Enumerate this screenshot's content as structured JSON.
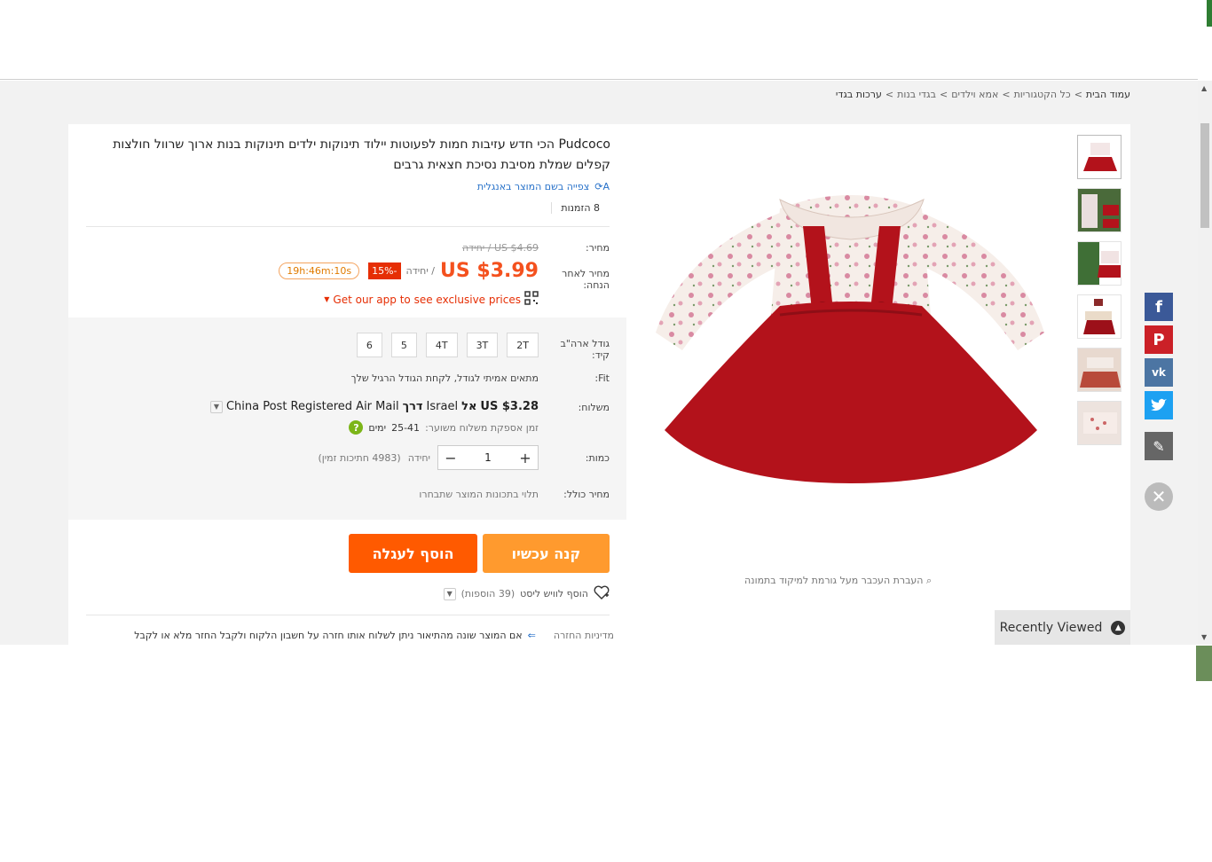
{
  "breadcrumb": [
    "עמוד הבית",
    "כל הקטגוריות",
    "אמא וילדים",
    "בגדי בנות",
    "ערכות בגדי"
  ],
  "product": {
    "title": "Pudcoco הכי חדש עזיבות חמות לפעוטות יילוד תינוקות ילדים תינוקות בנות ארוך שרוול חולצות קפלים שמלת מסיבת נסיכת חצאית גרבים",
    "translate_link": "צפייה בשם המוצר באנגלית",
    "orders": "8 הזמנות"
  },
  "price": {
    "label": "מחיר:",
    "old": "US $4.69 / יחידה",
    "discount_label": "מחיר לאחר הנחה:",
    "current": "US $3.99",
    "unit": "/ יחידה",
    "discount": "-15%",
    "timer": "19h:46m:10s",
    "app_text": "Get our app to see exclusive prices"
  },
  "sku": {
    "size_label": "גודל ארה\"ב קיד:",
    "sizes": [
      "2T",
      "3T",
      "4T",
      "5",
      "6"
    ],
    "fit_label": "Fit:",
    "fit_text": "מתאים אמיתי לגודל, לקחת הגודל הרגיל שלך",
    "ship_label": "משלוח:",
    "ship_price": "US $3.28",
    "ship_to": "אל",
    "ship_country": "Israel",
    "ship_via": "דרך",
    "ship_method": "China Post Registered Air Mail",
    "ship_time_label": "זמן אספקת משלוח משוער:",
    "ship_time": "25-41",
    "ship_time_unit": "ימים",
    "qty_label": "כמות:",
    "qty_value": "1",
    "qty_unit": "יחידה",
    "qty_avail": "(4983 חתיכות זמין)",
    "total_label": "מחיר כולל:",
    "total_text": "תלוי בתכונות המוצר שתבחרו"
  },
  "actions": {
    "buy_now": "קנה עכשיו",
    "add_cart": "הוסף לעגלה",
    "wishlist": "הוסף לוויש ליסט",
    "wish_count": "(39 הוספות)"
  },
  "return": {
    "label": "מדיניות החזרה",
    "text": "אם המוצר שונה מהתיאור ניתן לשלוח אותו חזרה על חשבון הלקוח ולקבל החזר מלא או לקבל"
  },
  "gallery": {
    "zoom_hint": "העברת העכבר מעל גורמת למיקוד בתמונה"
  },
  "recently_viewed": "Recently Viewed",
  "colors": {
    "accent": "#f4511e",
    "buy": "#ff9a2e",
    "cart": "#ff5a00",
    "dress": "#b3121b"
  }
}
